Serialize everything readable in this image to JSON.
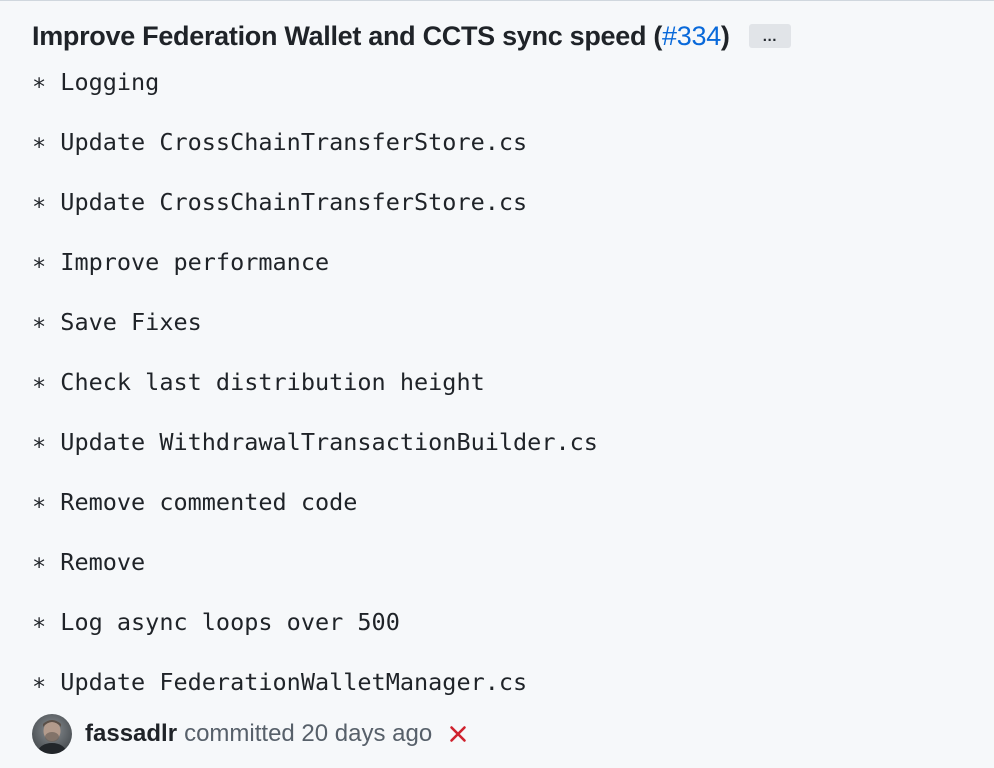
{
  "commit": {
    "title": "Improve Federation Wallet and CCTS sync speed (",
    "pr_link": "#334",
    "title_suffix": ")",
    "more_button": "…"
  },
  "message_lines": [
    "∗ Logging",
    "∗ Update CrossChainTransferStore.cs",
    "∗ Update CrossChainTransferStore.cs",
    "∗ Improve performance",
    "∗ Save Fixes",
    "∗ Check last distribution height",
    "∗ Update WithdrawalTransactionBuilder.cs",
    "∗ Remove commented code",
    "∗ Remove",
    "∗ Log async loops over 500",
    "∗ Update FederationWalletManager.cs"
  ],
  "footer": {
    "author": "fassadlr",
    "committed_text": "committed 20 days ago",
    "status_icon": "x-icon",
    "status_color": "#cf222e"
  },
  "colors": {
    "link": "#0969da",
    "background": "#f6f8fa",
    "muted": "#57606a"
  }
}
